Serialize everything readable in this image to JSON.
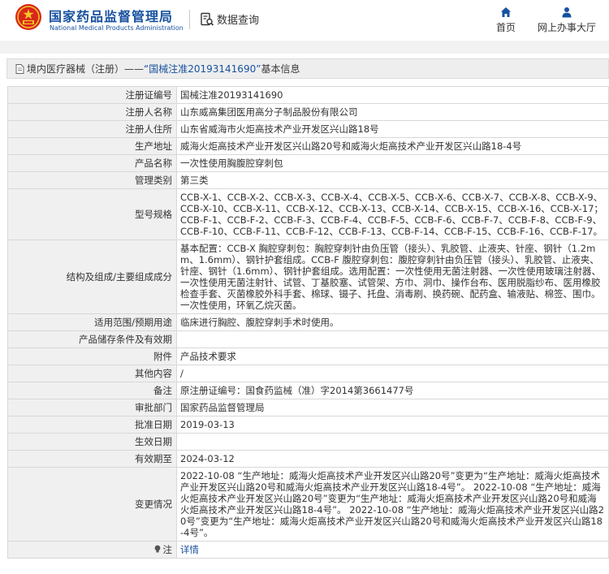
{
  "header": {
    "brand_cn": "国家药品监督管理局",
    "brand_en": "National Medical Products Administration",
    "search_label": "数据查询",
    "nav": [
      {
        "label": "首页",
        "icon": "home-icon"
      },
      {
        "label": "网上办事大厅",
        "icon": "user-icon"
      }
    ]
  },
  "title": {
    "prefix": "境内医疗器械（注册）——",
    "highlight": "“国械注准20193141690”",
    "suffix": "基本信息"
  },
  "rows": [
    {
      "key": "注册证编号",
      "value": "国械注准20193141690"
    },
    {
      "key": "注册人名称",
      "value": "山东威高集团医用高分子制品股份有限公司"
    },
    {
      "key": "注册人住所",
      "value": "山东省威海市火炬高技术产业开发区兴山路18号"
    },
    {
      "key": "生产地址",
      "value": "威海火炬高技术产业开发区兴山路20号和威海火炬高技术产业开发区兴山路18-4号"
    },
    {
      "key": "产品名称",
      "value": "一次性使用胸腹腔穿刺包"
    },
    {
      "key": "管理类别",
      "value": "第三类"
    },
    {
      "key": "型号规格",
      "value": "CCB-X-1、CCB-X-2、CCB-X-3、CCB-X-4、CCB-X-5、CCB-X-6、CCB-X-7、CCB-X-8、CCB-X-9、CCB-X-10、CCB-X-11、CCB-X-12、CCB-X-13、CCB-X-14、CCB-X-15、CCB-X-16、CCB-X-17；CCB-F-1、CCB-F-2、CCB-F-3、CCB-F-4、CCB-F-5、CCB-F-6、CCB-F-7、CCB-F-8、CCB-F-9、CCB-F-10、CCB-F-11、CCB-F-12、CCB-F-13、CCB-F-14、CCB-F-15、CCB-F-16、CCB-F-17。"
    },
    {
      "key": "结构及组成/主要组成成分",
      "value": "基本配置：CCB-X 胸腔穿刺包：胸腔穿刺针由负压管（接头）、乳胶管、止液夹、针座、钢针（1.2mm、1.6mm）、钢针护套组成。CCB-F 腹腔穿刺包：腹腔穿刺针由负压管（接头）、乳胶管、止液夹、针座、钢针（1.6mm）、钢针护套组成。选用配置：一次性使用无菌注射器、一次性使用玻璃注射器、一次性使用无菌注射针、试管、丁基胶塞、试管架、方巾、洞巾、操作台布、医用脱脂纱布、医用橡胶检查手套、灭菌橡胶外科手套、棉球、镊子、托盘、消毒刷、换药碗、配药盒、输液贴、棉签、围巾。一次性使用，环氧乙烷灭菌。"
    },
    {
      "key": "适用范围/预期用途",
      "value": "临床进行胸腔、腹腔穿刺手术时使用。"
    },
    {
      "key": "产品储存条件及有效期",
      "value": ""
    },
    {
      "key": "附件",
      "value": "产品技术要求"
    },
    {
      "key": "其他内容",
      "value": "/"
    },
    {
      "key": "备注",
      "value": "原注册证编号：国食药监械（准）字2014第3661477号"
    },
    {
      "key": "审批部门",
      "value": "国家药品监督管理局"
    },
    {
      "key": "批准日期",
      "value": "2019-03-13"
    },
    {
      "key": "生效日期",
      "value": ""
    },
    {
      "key": "有效期至",
      "value": "2024-03-12"
    },
    {
      "key": "变更情况",
      "value": "2022-10-08 “生产地址：威海火炬高技术产业开发区兴山路20号”变更为“生产地址：威海火炬高技术产业开发区兴山路20号和威海火炬高技术产业开发区兴山路18-4号”。 2022-10-08 “生产地址：威海火炬高技术产业开发区兴山路20号”变更为“生产地址：威海火炬高技术产业开发区兴山路20号和威海火炬高技术产业开发区兴山路18-4号”。 2022-10-08 “生产地址：威海火炬高技术产业开发区兴山路20号”变更为“生产地址：威海火炬高技术产业开发区兴山路20号和威海火炬高技术产业开发区兴山路18-4号”。"
    },
    {
      "key": "注",
      "value": "详情",
      "icon": "lightbulb-icon"
    }
  ],
  "colors": {
    "brand_blue": "#17519f",
    "key_bg": "#f0f0f0",
    "border": "#d8d8d8"
  }
}
